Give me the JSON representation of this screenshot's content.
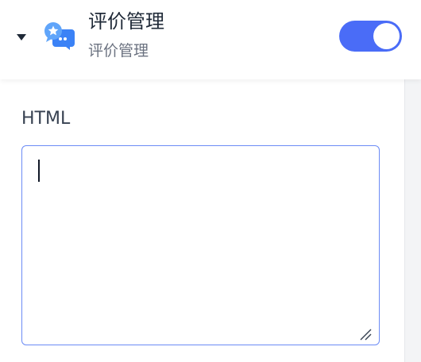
{
  "header": {
    "title": "评价管理",
    "subtitle": "评价管理",
    "toggle_on": true,
    "icon": "rating-chat-icon"
  },
  "field": {
    "label": "HTML",
    "value": ""
  },
  "colors": {
    "accent": "#4a6cf7",
    "textarea_border": "#6b8bf5",
    "icon_blue": "#3b82f6",
    "icon_light_blue": "#60a5fa"
  }
}
